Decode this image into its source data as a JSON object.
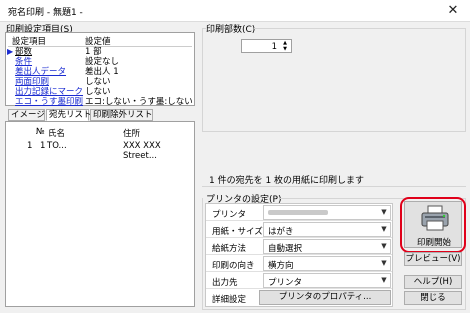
{
  "window": {
    "title": "宛名印刷 - 無題1 -",
    "close_glyph": "✕"
  },
  "settings_panel": {
    "group_label": "印刷設定項目(S)",
    "headers": [
      "設定項目",
      "設定値"
    ],
    "rows": [
      {
        "item": "部数",
        "value": "1 部",
        "selected": true,
        "link": false
      },
      {
        "item": "条件",
        "value": "設定なし",
        "link": true
      },
      {
        "item": "差出人データ",
        "value": "差出人 1",
        "link": true
      },
      {
        "item": "両面印刷",
        "value": "しない",
        "link": true
      },
      {
        "item": "出力記録にマーク",
        "value": "しない",
        "link": true
      },
      {
        "item": "エコ・うす墨印刷",
        "value": "エコ:しない・うす墨:しない",
        "link": true
      }
    ]
  },
  "tabs": [
    "イメージ",
    "宛先リスト",
    "印刷除外リスト"
  ],
  "list": {
    "headers": [
      "№",
      "氏名",
      "住所"
    ],
    "rows": [
      {
        "idx": "1",
        "no": "1",
        "name": "TO...",
        "address": "XXX XXX Street..."
      }
    ]
  },
  "copies": {
    "label": "印刷部数(C)",
    "value": "1",
    "up": "▲",
    "down": "▼"
  },
  "info_text": "1 件の宛先を 1 枚の用紙に印刷します",
  "printer": {
    "group_label": "プリンタの設定(P)",
    "rows": [
      {
        "label": "プリンタ",
        "value": "",
        "blurred": true
      },
      {
        "label": "用紙・サイズ",
        "value": "はがき"
      },
      {
        "label": "給紙方法",
        "value": "自動選択"
      },
      {
        "label": "印刷の向き",
        "value": "横方向"
      },
      {
        "label": "出力先",
        "value": "プリンタ"
      }
    ],
    "detail_label": "詳細設定",
    "properties_button": "プリンタのプロパティ..."
  },
  "buttons": {
    "print": "印刷開始",
    "preview": "プレビュー(V)",
    "help": "ヘルプ(H)",
    "close": "閉じる"
  },
  "colors": {
    "link": "#1a2bd1",
    "highlight": "#e0001a"
  }
}
